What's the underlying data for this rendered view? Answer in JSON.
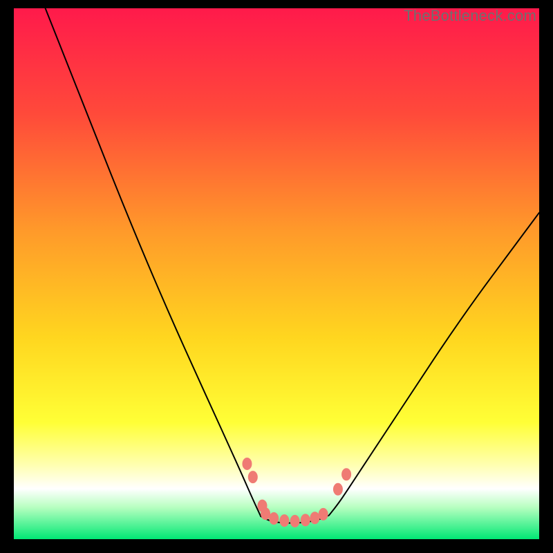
{
  "watermark": {
    "text": "TheBottleneck.com"
  },
  "chart_data": {
    "type": "line",
    "title": "",
    "xlabel": "",
    "ylabel": "",
    "xlim": [
      0,
      100
    ],
    "ylim": [
      0,
      100
    ],
    "grid": false,
    "legend": false,
    "background_gradient": {
      "stops": [
        {
          "offset": 0.0,
          "color": "#ff1a4b"
        },
        {
          "offset": 0.2,
          "color": "#ff4a3a"
        },
        {
          "offset": 0.42,
          "color": "#ff9a2a"
        },
        {
          "offset": 0.62,
          "color": "#ffd61f"
        },
        {
          "offset": 0.78,
          "color": "#ffff36"
        },
        {
          "offset": 0.86,
          "color": "#ffffb0"
        },
        {
          "offset": 0.905,
          "color": "#ffffff"
        },
        {
          "offset": 0.94,
          "color": "#b7ffc0"
        },
        {
          "offset": 1.0,
          "color": "#00e874"
        }
      ]
    },
    "series": [
      {
        "name": "left-curve",
        "stroke": "#000000",
        "stroke_width": 2,
        "points": [
          {
            "x": 6.0,
            "y": 100.0
          },
          {
            "x": 10.0,
            "y": 90.0
          },
          {
            "x": 15.0,
            "y": 77.5
          },
          {
            "x": 20.0,
            "y": 65.0
          },
          {
            "x": 25.0,
            "y": 53.0
          },
          {
            "x": 30.0,
            "y": 41.5
          },
          {
            "x": 35.0,
            "y": 30.5
          },
          {
            "x": 38.0,
            "y": 24.0
          },
          {
            "x": 41.0,
            "y": 17.5
          },
          {
            "x": 43.5,
            "y": 12.0
          },
          {
            "x": 45.5,
            "y": 7.5
          },
          {
            "x": 47.0,
            "y": 4.3
          }
        ]
      },
      {
        "name": "floor",
        "stroke": "#000000",
        "stroke_width": 2,
        "points": [
          {
            "x": 47.0,
            "y": 4.3
          },
          {
            "x": 49.0,
            "y": 3.3
          },
          {
            "x": 52.0,
            "y": 3.0
          },
          {
            "x": 55.0,
            "y": 3.1
          },
          {
            "x": 58.0,
            "y": 3.6
          },
          {
            "x": 60.0,
            "y": 4.5
          }
        ]
      },
      {
        "name": "right-curve",
        "stroke": "#000000",
        "stroke_width": 2,
        "points": [
          {
            "x": 60.0,
            "y": 4.5
          },
          {
            "x": 62.0,
            "y": 7.0
          },
          {
            "x": 64.0,
            "y": 10.0
          },
          {
            "x": 67.0,
            "y": 14.5
          },
          {
            "x": 71.0,
            "y": 20.5
          },
          {
            "x": 76.0,
            "y": 28.0
          },
          {
            "x": 82.0,
            "y": 37.0
          },
          {
            "x": 88.0,
            "y": 45.5
          },
          {
            "x": 94.0,
            "y": 53.5
          },
          {
            "x": 100.0,
            "y": 61.5
          }
        ]
      }
    ],
    "markers": {
      "name": "overlay-dots",
      "fill": "#ef7b74",
      "rx": 7,
      "ry": 9,
      "points": [
        {
          "x": 44.4,
          "y": 14.2
        },
        {
          "x": 45.5,
          "y": 11.7
        },
        {
          "x": 47.3,
          "y": 6.3
        },
        {
          "x": 47.9,
          "y": 4.8
        },
        {
          "x": 49.5,
          "y": 3.9
        },
        {
          "x": 51.5,
          "y": 3.5
        },
        {
          "x": 53.5,
          "y": 3.4
        },
        {
          "x": 55.5,
          "y": 3.6
        },
        {
          "x": 57.3,
          "y": 4.0
        },
        {
          "x": 58.9,
          "y": 4.7
        },
        {
          "x": 61.7,
          "y": 9.4
        },
        {
          "x": 63.3,
          "y": 12.2
        }
      ]
    }
  }
}
